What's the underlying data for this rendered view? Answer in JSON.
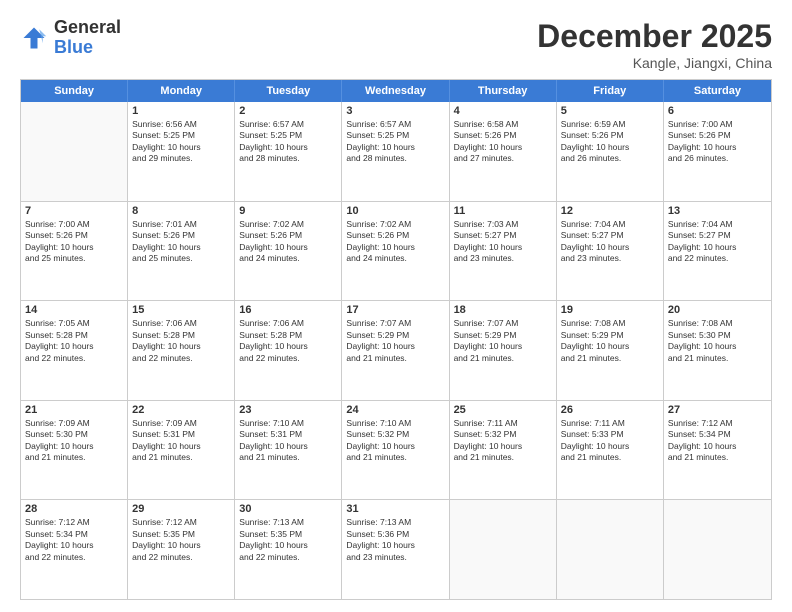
{
  "header": {
    "logo_general": "General",
    "logo_blue": "Blue",
    "month_title": "December 2025",
    "location": "Kangle, Jiangxi, China"
  },
  "weekdays": [
    "Sunday",
    "Monday",
    "Tuesday",
    "Wednesday",
    "Thursday",
    "Friday",
    "Saturday"
  ],
  "rows": [
    [
      {
        "day": "",
        "info": ""
      },
      {
        "day": "1",
        "info": "Sunrise: 6:56 AM\nSunset: 5:25 PM\nDaylight: 10 hours\nand 29 minutes."
      },
      {
        "day": "2",
        "info": "Sunrise: 6:57 AM\nSunset: 5:25 PM\nDaylight: 10 hours\nand 28 minutes."
      },
      {
        "day": "3",
        "info": "Sunrise: 6:57 AM\nSunset: 5:25 PM\nDaylight: 10 hours\nand 28 minutes."
      },
      {
        "day": "4",
        "info": "Sunrise: 6:58 AM\nSunset: 5:26 PM\nDaylight: 10 hours\nand 27 minutes."
      },
      {
        "day": "5",
        "info": "Sunrise: 6:59 AM\nSunset: 5:26 PM\nDaylight: 10 hours\nand 26 minutes."
      },
      {
        "day": "6",
        "info": "Sunrise: 7:00 AM\nSunset: 5:26 PM\nDaylight: 10 hours\nand 26 minutes."
      }
    ],
    [
      {
        "day": "7",
        "info": "Sunrise: 7:00 AM\nSunset: 5:26 PM\nDaylight: 10 hours\nand 25 minutes."
      },
      {
        "day": "8",
        "info": "Sunrise: 7:01 AM\nSunset: 5:26 PM\nDaylight: 10 hours\nand 25 minutes."
      },
      {
        "day": "9",
        "info": "Sunrise: 7:02 AM\nSunset: 5:26 PM\nDaylight: 10 hours\nand 24 minutes."
      },
      {
        "day": "10",
        "info": "Sunrise: 7:02 AM\nSunset: 5:26 PM\nDaylight: 10 hours\nand 24 minutes."
      },
      {
        "day": "11",
        "info": "Sunrise: 7:03 AM\nSunset: 5:27 PM\nDaylight: 10 hours\nand 23 minutes."
      },
      {
        "day": "12",
        "info": "Sunrise: 7:04 AM\nSunset: 5:27 PM\nDaylight: 10 hours\nand 23 minutes."
      },
      {
        "day": "13",
        "info": "Sunrise: 7:04 AM\nSunset: 5:27 PM\nDaylight: 10 hours\nand 22 minutes."
      }
    ],
    [
      {
        "day": "14",
        "info": "Sunrise: 7:05 AM\nSunset: 5:28 PM\nDaylight: 10 hours\nand 22 minutes."
      },
      {
        "day": "15",
        "info": "Sunrise: 7:06 AM\nSunset: 5:28 PM\nDaylight: 10 hours\nand 22 minutes."
      },
      {
        "day": "16",
        "info": "Sunrise: 7:06 AM\nSunset: 5:28 PM\nDaylight: 10 hours\nand 22 minutes."
      },
      {
        "day": "17",
        "info": "Sunrise: 7:07 AM\nSunset: 5:29 PM\nDaylight: 10 hours\nand 21 minutes."
      },
      {
        "day": "18",
        "info": "Sunrise: 7:07 AM\nSunset: 5:29 PM\nDaylight: 10 hours\nand 21 minutes."
      },
      {
        "day": "19",
        "info": "Sunrise: 7:08 AM\nSunset: 5:29 PM\nDaylight: 10 hours\nand 21 minutes."
      },
      {
        "day": "20",
        "info": "Sunrise: 7:08 AM\nSunset: 5:30 PM\nDaylight: 10 hours\nand 21 minutes."
      }
    ],
    [
      {
        "day": "21",
        "info": "Sunrise: 7:09 AM\nSunset: 5:30 PM\nDaylight: 10 hours\nand 21 minutes."
      },
      {
        "day": "22",
        "info": "Sunrise: 7:09 AM\nSunset: 5:31 PM\nDaylight: 10 hours\nand 21 minutes."
      },
      {
        "day": "23",
        "info": "Sunrise: 7:10 AM\nSunset: 5:31 PM\nDaylight: 10 hours\nand 21 minutes."
      },
      {
        "day": "24",
        "info": "Sunrise: 7:10 AM\nSunset: 5:32 PM\nDaylight: 10 hours\nand 21 minutes."
      },
      {
        "day": "25",
        "info": "Sunrise: 7:11 AM\nSunset: 5:32 PM\nDaylight: 10 hours\nand 21 minutes."
      },
      {
        "day": "26",
        "info": "Sunrise: 7:11 AM\nSunset: 5:33 PM\nDaylight: 10 hours\nand 21 minutes."
      },
      {
        "day": "27",
        "info": "Sunrise: 7:12 AM\nSunset: 5:34 PM\nDaylight: 10 hours\nand 21 minutes."
      }
    ],
    [
      {
        "day": "28",
        "info": "Sunrise: 7:12 AM\nSunset: 5:34 PM\nDaylight: 10 hours\nand 22 minutes."
      },
      {
        "day": "29",
        "info": "Sunrise: 7:12 AM\nSunset: 5:35 PM\nDaylight: 10 hours\nand 22 minutes."
      },
      {
        "day": "30",
        "info": "Sunrise: 7:13 AM\nSunset: 5:35 PM\nDaylight: 10 hours\nand 22 minutes."
      },
      {
        "day": "31",
        "info": "Sunrise: 7:13 AM\nSunset: 5:36 PM\nDaylight: 10 hours\nand 23 minutes."
      },
      {
        "day": "",
        "info": ""
      },
      {
        "day": "",
        "info": ""
      },
      {
        "day": "",
        "info": ""
      }
    ]
  ]
}
